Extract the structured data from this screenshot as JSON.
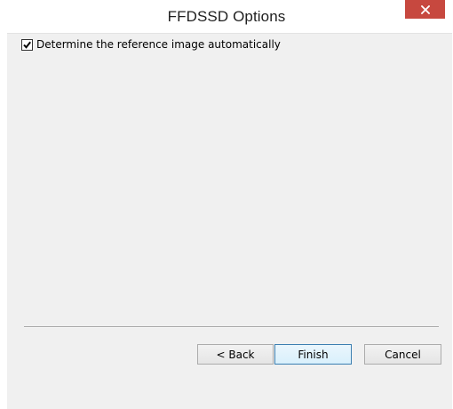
{
  "window": {
    "title": "FFDSSD Options",
    "close_icon": "close-icon",
    "close_color": "#c7483f"
  },
  "options": {
    "auto_reference_label": "Determine the reference image automatically",
    "auto_reference_checked": true
  },
  "buttons": {
    "back_label": "< Back",
    "finish_label": "Finish",
    "cancel_label": "Cancel"
  }
}
